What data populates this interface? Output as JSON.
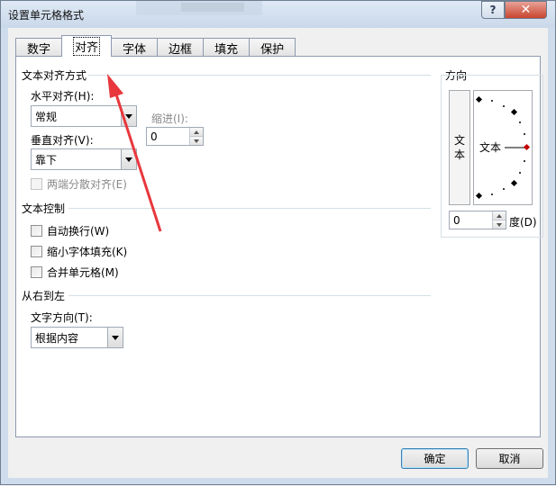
{
  "window": {
    "title": "设置单元格格式",
    "help_glyph": "?",
    "close_glyph": "✕"
  },
  "tabs": [
    {
      "label": "数字"
    },
    {
      "label": "对齐"
    },
    {
      "label": "字体"
    },
    {
      "label": "边框"
    },
    {
      "label": "填充"
    },
    {
      "label": "保护"
    }
  ],
  "active_tab": "对齐",
  "text_alignment": {
    "group_label": "文本对齐方式",
    "horizontal_label": "水平对齐(H):",
    "horizontal_value": "常规",
    "indent_label": "缩进(I):",
    "indent_value": "0",
    "vertical_label": "垂直对齐(V):",
    "vertical_value": "靠下",
    "distributed_label": "两端分散对齐(E)"
  },
  "text_control": {
    "group_label": "文本控制",
    "wrap_label": "自动换行(W)",
    "shrink_label": "缩小字体填充(K)",
    "merge_label": "合并单元格(M)"
  },
  "rtl": {
    "group_label": "从右到左",
    "direction_label": "文字方向(T):",
    "direction_value": "根据内容"
  },
  "orientation": {
    "group_label": "方向",
    "vertical_text_1": "文",
    "vertical_text_2": "本",
    "dial_text": "文本",
    "degrees_value": "0",
    "degrees_label": "度(D)"
  },
  "buttons": {
    "ok": "确定",
    "cancel": "取消"
  },
  "colors": {
    "annotation_arrow": "#e8383d",
    "close_button": "#c9452f",
    "dial_marker": "#c00000"
  }
}
